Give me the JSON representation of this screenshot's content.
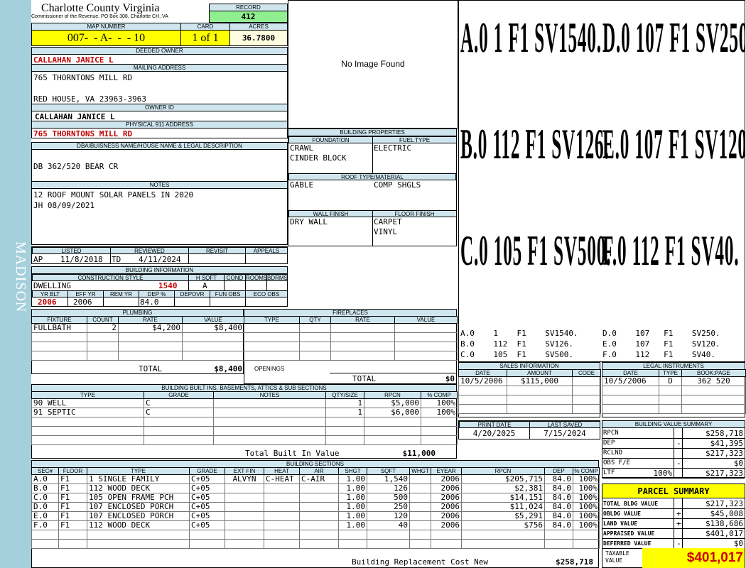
{
  "side_label": "MADISON",
  "header": {
    "title": "Charlotte County Virginia",
    "subtitle": "Commissioner of the Revenue, PO Box 308, Charlotte CH, VA",
    "record_label": "RECORD",
    "record": "412"
  },
  "map": {
    "map_label": "MAP NUMBER",
    "map_number": "007-  - A-  -  - 10",
    "card_label": "CARD",
    "card": "1 of 1",
    "acres_label": "ACRES",
    "acres": "36.7800"
  },
  "owner": {
    "deeded_label": "DEEDED OWNER",
    "deeded": "CALLAHAN JANICE L",
    "mailing_label": "MAILING ADDRESS",
    "mail1": "765 THORNTONS MILL RD",
    "mail2": "RED HOUSE, VA 23963-3963",
    "owner_id_label": "OWNER ID",
    "owner_id": "CALLAHAN JANICE L",
    "addr911_label": "PHYSICAL 911 ADDRESS",
    "addr911": "765 THORNTONS MILL RD"
  },
  "dba": {
    "label": "DBA/BUISNESS NAME/HOUSE NAME & LEGAL DESCRIPTION",
    "text": "DB 362/520 BEAR CR"
  },
  "notes": {
    "label": "NOTES",
    "line1": "12 ROOF MOUNT SOLAR PANELS IN 2020",
    "line2": "JH 08/09/2021"
  },
  "photo": {
    "text": "No Image Found"
  },
  "building_props": {
    "label": "BUILDING PROPERTIES",
    "foundation_label": "FOUNDATION",
    "fuel_label": "FUEL TYPE",
    "foundation1": "CRAWL",
    "foundation2": "CINDER BLOCK",
    "fuel": "ELECTRIC",
    "roof_label": "ROOF TYPE/MATERIAL",
    "roof_type": "GABLE",
    "roof_material": "COMP SHGLS",
    "wall_label": "WALL FINISH",
    "floor_label": "FLOOR FINISH",
    "wall": "DRY WALL",
    "floor1": "CARPET",
    "floor2": "VINYL"
  },
  "sketch": {
    "rows": [
      [
        "A.0",
        "1",
        "F1",
        "SV1540.",
        "D.0",
        "107",
        "F1",
        "SV250."
      ],
      [
        "B.0",
        "112",
        "F1",
        "SV126.",
        "E.0",
        "107",
        "F1",
        "SV120."
      ],
      [
        "C.0",
        "105",
        "F1",
        "SV500.",
        "F.0",
        "112",
        "F1",
        "SV40."
      ]
    ],
    "legend": [
      "A.0    1    F1    SV1540.",
      "B.0    112  F1    SV126.",
      "C.0    105  F1    SV500."
    ],
    "legend2": [
      "D.0    107   F1    SV250.",
      "E.0    107   F1    SV120.",
      "F.0    112   F1    SV40."
    ]
  },
  "listing": {
    "listed_label": "LISTED",
    "reviewed_label": "REVIEWED",
    "revisit_label": "REVISIT",
    "appeals_label": "APPEALS",
    "listed_by": "AP",
    "listed_date": "11/8/2018",
    "reviewed_by": "TD",
    "reviewed_date": "4/11/2024"
  },
  "building_info": {
    "label": "BUILDING INFORMATION",
    "style_label": "CONSTRUCTION STYLE",
    "hsqft_label": "H SQFT",
    "cond_label": "COND",
    "rooms_label": "ROOMS",
    "bdrms_label": "BDRMS",
    "style": "DWELLING",
    "hsqft": "1540",
    "cond": "A",
    "yrblt_label": "YR BLT",
    "effyr_label": "EFF YR",
    "remyr_label": "REM YR",
    "dep_label": "DEP %",
    "depovr_label": "DEPOVR",
    "funobs_label": "FUN OBS",
    "ecoobs_label": "ECO OBS",
    "yrblt": "2006",
    "effyr": "2006",
    "dep": "84.0"
  },
  "plumbing": {
    "label": "PLUMBING",
    "headers": [
      "FIXTURE",
      "COUNT",
      "RATE",
      "VALUE"
    ],
    "rows": [
      [
        "FULLBATH",
        "2",
        "$4,200",
        "$8,400"
      ]
    ],
    "total_label": "TOTAL",
    "total": "$8,400"
  },
  "fireplaces": {
    "label": "FIREPLACES",
    "headers": [
      "TYPE",
      "QTY",
      "RATE",
      "VALUE"
    ],
    "openings_label": "OPENINGS",
    "total_label": "TOTAL",
    "total": "$0"
  },
  "builtins": {
    "label": "BUILDING BUILT INS, BASEMENTS, ATTICS & SUB SECTIONS",
    "headers": [
      "TYPE",
      "GRADE",
      "NOTES",
      "QTY/SIZE",
      "RPCN",
      "% COMP"
    ],
    "rows": [
      [
        "90 WELL",
        "C",
        "",
        "1",
        "$5,000",
        "100%"
      ],
      [
        "91 SEPTIC",
        "C",
        "",
        "1",
        "$6,000",
        "100%"
      ]
    ],
    "total_label": "Total Built In Value",
    "total": "$11,000"
  },
  "sections": {
    "label": "BUILDING SECTIONS",
    "headers": [
      "SEC#",
      "FLOOR",
      "TYPE",
      "GRADE",
      "EXT FIN",
      "HEAT",
      "AIR",
      "SHGT",
      "SQFT",
      "WHGT",
      "EYEAR",
      "RPCN",
      "DEP",
      "% COMP"
    ],
    "rows": [
      [
        "A.0",
        "F1",
        "1 SINGLE FAMILY",
        "C+05",
        "ALVYN",
        "C-HEAT",
        "C-AIR",
        "1.00",
        "1,540",
        "",
        "2006",
        "$205,715",
        "84.0",
        "100%"
      ],
      [
        "B.0",
        "F1",
        "112 WOOD DECK",
        "C+05",
        "",
        "",
        "",
        "1.00",
        "126",
        "",
        "2006",
        "$2,381",
        "84.0",
        "100%"
      ],
      [
        "C.0",
        "F1",
        "105 OPEN FRAME PCH",
        "C+05",
        "",
        "",
        "",
        "1.00",
        "500",
        "",
        "2006",
        "$14,151",
        "84.0",
        "100%"
      ],
      [
        "D.0",
        "F1",
        "107 ENCLOSED PORCH",
        "C+05",
        "",
        "",
        "",
        "1.00",
        "250",
        "",
        "2006",
        "$11,024",
        "84.0",
        "100%"
      ],
      [
        "E.0",
        "F1",
        "107 ENCLOSED PORCH",
        "C+05",
        "",
        "",
        "",
        "1.00",
        "120",
        "",
        "2006",
        "$5,291",
        "84.0",
        "100%"
      ],
      [
        "F.0",
        "F1",
        "112 WOOD DECK",
        "C+05",
        "",
        "",
        "",
        "1.00",
        "40",
        "",
        "2006",
        "$756",
        "84.0",
        "100%"
      ]
    ],
    "total_label": "Building Replacement Cost New",
    "total": "$258,718"
  },
  "sales": {
    "label": "SALES INFORMATION",
    "headers": [
      "DATE",
      "AMOUNT",
      "CODE"
    ],
    "rows": [
      [
        "10/5/2006",
        "$115,000",
        ""
      ]
    ]
  },
  "legal": {
    "label": "LEGAL INSTRUMENTS",
    "headers": [
      "DATE",
      "TYPE",
      "BOOK:PAGE"
    ],
    "rows": [
      [
        "10/5/2006",
        "D",
        "362 520"
      ]
    ]
  },
  "dates": {
    "print_label": "PRINT DATE",
    "saved_label": "LAST SAVED",
    "print_date": "4/20/2025",
    "last_saved": "7/15/2024"
  },
  "value_summary": {
    "label": "BUILDING VALUE SUMMARY",
    "rows": [
      {
        "k": "RPCN",
        "s": "",
        "v": "$258,718"
      },
      {
        "k": "DEP",
        "s": "-",
        "v": "$41,395"
      },
      {
        "k": "RCLND",
        "s": "",
        "v": "$217,323"
      },
      {
        "k": "OBS F/E",
        "s": "-",
        "v": "$0"
      },
      {
        "k": "LTF",
        "p": "100%",
        "s": "",
        "v": "$217,323"
      }
    ]
  },
  "parcel": {
    "label": "PARCEL SUMMARY",
    "rows": [
      {
        "k": "TOTAL BLDG VALUE",
        "s": "",
        "v": "$217,323"
      },
      {
        "k": "OBLDG VALUE",
        "s": "+",
        "v": "$45,008"
      },
      {
        "k": "LAND VALUE",
        "s": "+",
        "v": "$138,686"
      },
      {
        "k": "APPRAISED VALUE",
        "s": "",
        "v": "$401,017"
      },
      {
        "k": "DEFERRED VALUE",
        "s": "-",
        "v": "$0"
      }
    ],
    "taxable_label1": "TAXABLE",
    "taxable_label2": "VALUE",
    "taxable": "$401,017"
  }
}
